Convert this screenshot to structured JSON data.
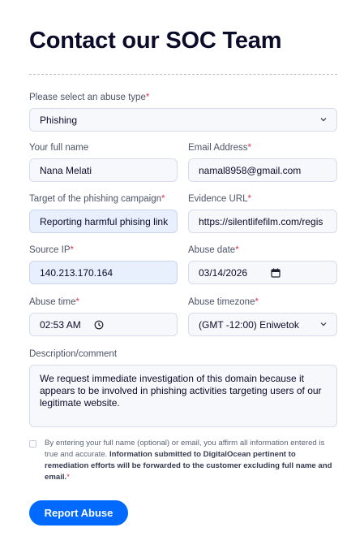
{
  "page": {
    "title": "Contact our SOC Team"
  },
  "form": {
    "abuse_type": {
      "label": "Please select an abuse type",
      "required": "*",
      "value": "Phishing"
    },
    "full_name": {
      "label": "Your full name",
      "value": "Nana Melati"
    },
    "email": {
      "label": "Email Address",
      "required": "*",
      "value": "namal8958@gmail.com"
    },
    "target": {
      "label": "Target of the phishing campaign",
      "required": "*",
      "value": "Reporting harmful phising link"
    },
    "evidence_url": {
      "label": "Evidence URL",
      "required": "*",
      "value": "https://silentlifefilm.com/regis"
    },
    "source_ip": {
      "label": "Source IP",
      "required": "*",
      "value": "140.213.170.164"
    },
    "abuse_date": {
      "label": "Abuse date",
      "required": "*",
      "value": "03/14/2026"
    },
    "abuse_time": {
      "label": "Abuse time",
      "required": "*",
      "value": "02:53 AM"
    },
    "abuse_timezone": {
      "label": "Abuse timezone",
      "required": "*",
      "value": "(GMT -12:00) Eniwetok"
    },
    "description": {
      "label": "Description/comment",
      "value": "We request immediate investigation of this domain because it appears to be involved in phishing activities targeting users of our legitimate website."
    },
    "consent": {
      "text": "By entering your full name (optional) or email, you affirm all information entered is true and accurate. ",
      "bold": "Information submitted to DigitalOcean pertinent to remediation efforts will be forwarded to the customer excluding full name and email.",
      "required": "*",
      "checked": false
    },
    "submit_label": "Report Abuse"
  },
  "colors": {
    "accent": "#0069ff",
    "required": "#e0364d",
    "filled_bg": "#e9f0fd"
  },
  "icons": [
    "chevron-down-icon",
    "calendar-icon",
    "clock-icon",
    "checkbox"
  ]
}
